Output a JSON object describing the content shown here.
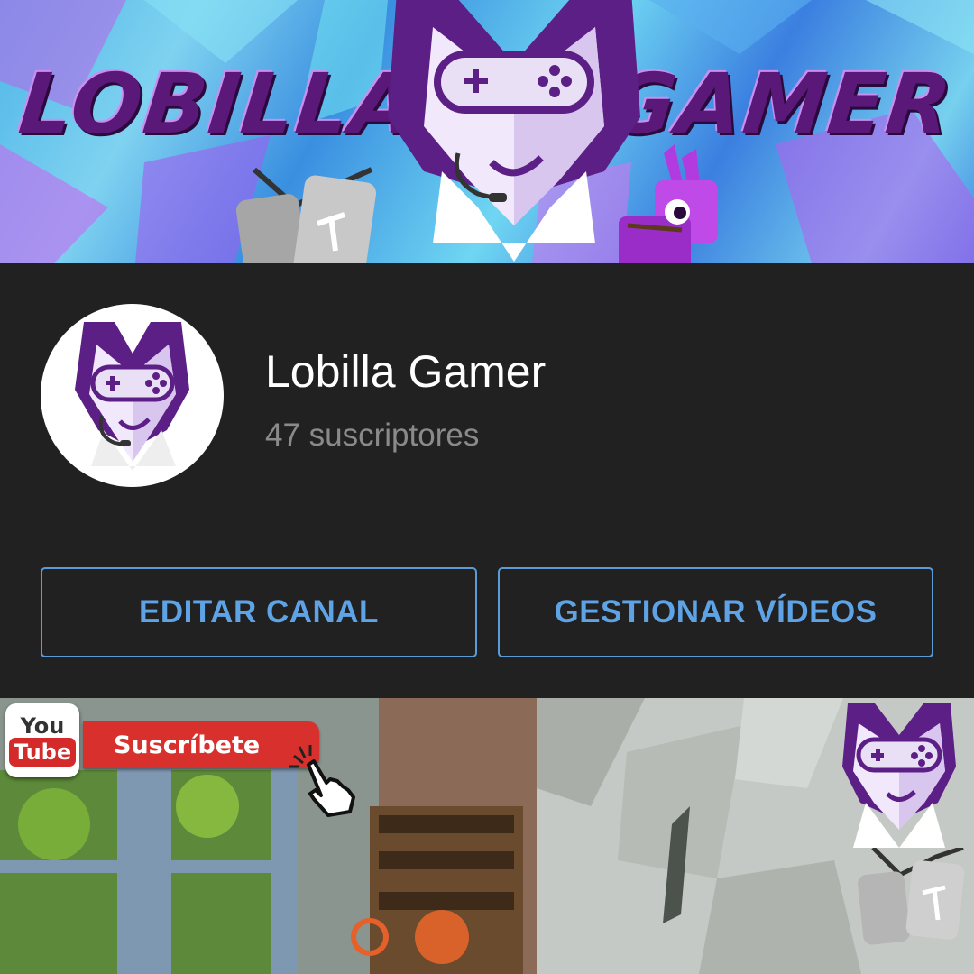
{
  "banner": {
    "title_left": "LOBILLA",
    "title_right": "GAMER",
    "colors": {
      "title": "#5a1878",
      "background": "#4fb6e8"
    }
  },
  "channel": {
    "name": "Lobilla Gamer",
    "subscribers": "47 suscriptores",
    "avatar_icon": "wolf-gamepad-logo"
  },
  "actions": {
    "edit_label": "EDITAR CANAL",
    "manage_label": "GESTIONAR VÍDEOS",
    "accent": "#5ea3e6"
  },
  "video": {
    "youtube_you": "You",
    "youtube_tube": "Tube",
    "subscribe_label": "Suscríbete",
    "cursor_icon": "hand-pointer-icon"
  }
}
